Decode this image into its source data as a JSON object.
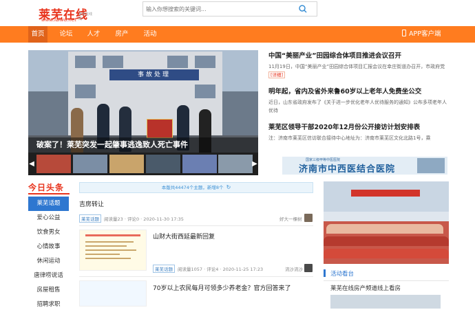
{
  "header": {
    "logo_text": "莱芜在线",
    "logo_url": "www.laiwu.net",
    "logo_sub": "莱芜在线 网",
    "search_placeholder": "输入你想搜索的关键词..."
  },
  "nav": {
    "items": [
      "首页",
      "论坛",
      "人才",
      "房产",
      "活动"
    ],
    "app_label": "APP客户端"
  },
  "banner": {
    "sign": "事故处理",
    "caption": "破案了！莱芜突发一起肇事逃逸致人死亡事件",
    "flag_text": "破案 零容"
  },
  "headlines": [
    {
      "title": "中国“美丽产业”田园综合体项目推进会议召开",
      "desc": "11月19日，中国“美丽产业”田园综合体项目汇报会议在幸庄街道办召开，市政府党",
      "more": "[详细]"
    },
    {
      "title": "明年起，省内及省外来鲁60岁以上老年人免费坐公交",
      "desc": "近日，山东省政府发布了《关于进一步优化老年人优待服务的通知》公布多项老年人优待"
    },
    {
      "title": "莱芜区领导干部2020年12月份公开接访计划安排表",
      "desc": "注：济南市莱芜区信访联合接待中心地址为：济南市莱芜区文化北路1号，乘"
    }
  ],
  "ad": {
    "small": "国家三级甲等中医医院",
    "big": "济南市中西医结合医院"
  },
  "sidebar": {
    "title": "今日头条",
    "items": [
      "莱芜话题",
      "爱心公益",
      "饮食男女",
      "心情故事",
      "休闲运动",
      "唐律唠说话",
      "房屋租售",
      "招聘求职"
    ]
  },
  "feed": {
    "notice": "本版共44474个主题，新增8个",
    "refresh_icon": "↻",
    "posts": [
      {
        "title": "吉房转让",
        "tag": "莱芜话题",
        "meta": "阅读量23 · 评论0 · 2020-11-30 17:35",
        "author": "好大一棵树"
      },
      {
        "title": "山财大街西延最新回复",
        "tag": "莱芜话题",
        "meta": "阅读量1057 · 评论4 · 2020-11-25 17:23",
        "author": "流沙流沙"
      },
      {
        "title": "70岁以上农民每月可领多少养老金？官方回答来了"
      }
    ]
  },
  "activity": {
    "label": "活动看台",
    "link": "莱芜在线房产频道线上看房"
  },
  "colors": {
    "nav_bg": "#ff7c1f",
    "brand_red": "#e8321b",
    "accent_blue": "#2e77d0"
  }
}
